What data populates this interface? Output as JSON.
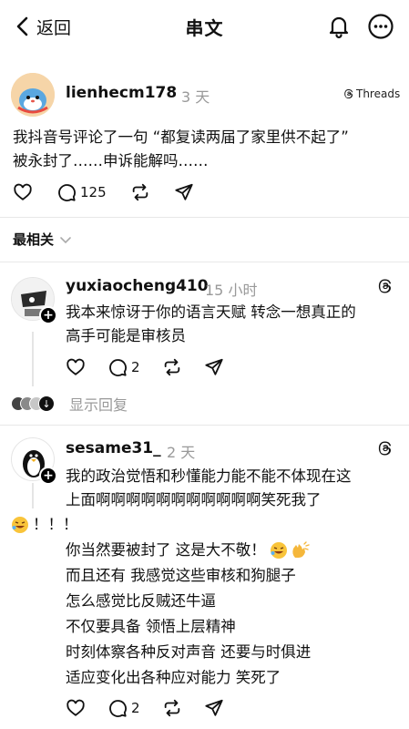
{
  "nav": {
    "back_label": "返回",
    "title": "串文"
  },
  "post": {
    "username": "lienhecm178",
    "time": "3 天",
    "brand": "Threads",
    "text_line1": "我抖音号评论了一句 “都复读两届了家里供不起了”",
    "text_line2": "被永封了……申诉能解吗……",
    "reply_count": "125"
  },
  "sort": {
    "label": "最相关"
  },
  "comment1": {
    "username": "yuxiaocheng410",
    "time": "15 小时",
    "line1": "我本来惊讶于你的语言天赋 转念一想真正的",
    "line2": "高手可能是审核员",
    "reply_count": "2",
    "show_replies": "显示回复"
  },
  "comment2": {
    "username": "sesame31_",
    "time": "2 天",
    "line1": "我的政治觉悟和秒懂能力能不能不体现在这",
    "line2": "上面啊啊啊啊啊啊啊啊啊啊啊笑死我了",
    "line3": "！！！",
    "line4": "你当然要被封了 这是大不敬！",
    "line5": "而且还有 我感觉这些审核和狗腿子",
    "line6": "怎么感觉比反贼还牛逼",
    "line7": "不仅要具备 领悟上层精神",
    "line8": "时刻体察各种反对声音 还要与时俱进",
    "line9": "适应变化出各种应对能力 笑死了",
    "reply_count": "2"
  },
  "icons": {
    "back": "chevron-left-icon",
    "bell": "bell-icon",
    "more": "more-icon",
    "heart": "heart-icon",
    "comment": "comment-icon",
    "repost": "repost-icon",
    "share": "send-icon",
    "threads": "threads-logo-icon",
    "chevron": "chevron-down-icon",
    "emoji_laugh": "rofl-emoji",
    "emoji_clap": "clapping-hands-emoji"
  },
  "colors": {
    "text": "#111111",
    "muted": "#999999",
    "divider": "#e8e8e8"
  }
}
